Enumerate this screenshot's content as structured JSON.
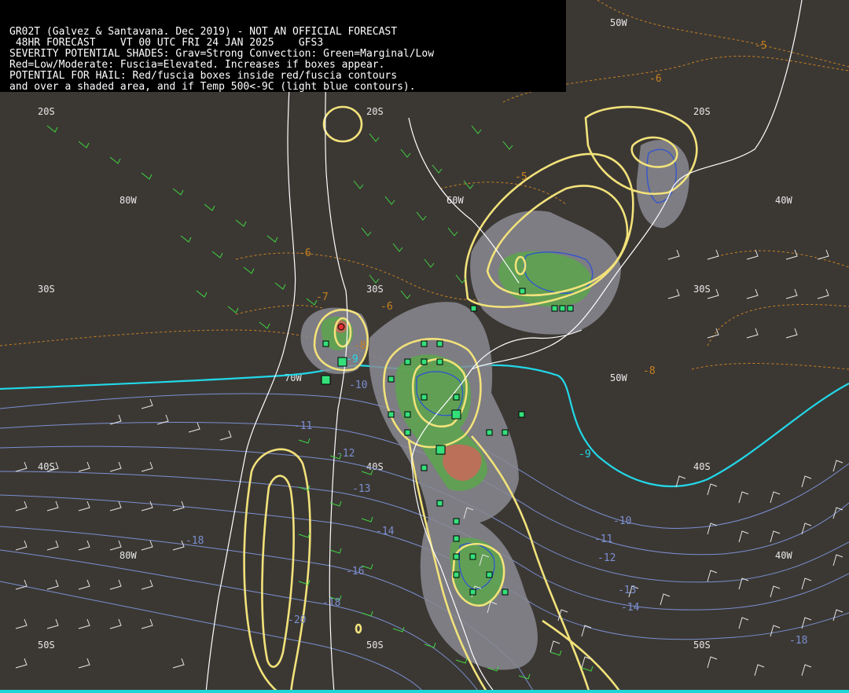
{
  "header": {
    "lines": [
      "GR02T (Galvez & Santavana. Dec 2019) - NOT AN OFFICIAL FORECAST",
      " 48HR FORECAST    VT 00 UTC FRI 24 JAN 2025    GFS3",
      "SEVERITY POTENTIAL SHADES: Grav=Strong Convection: Green=Marginal/Low",
      "Red=Low/Moderate: Fuscia=Elevated. Increases if boxes appear.",
      "POTENTIAL FOR HAIL: Red/fuscia boxes inside red/fuscia contours",
      "and over a shaded area, and if Temp 500<-9C (light blue contours)."
    ]
  },
  "grid_labels": {
    "lat_20s": "20S",
    "lat_30s": "30S",
    "lat_40s": "40S",
    "lat_50s": "50S",
    "lon_80w": "80W",
    "lon_70w": "70W",
    "lon_60w": "60W",
    "lon_50w": "50W",
    "lon_40w": "40W"
  },
  "contour_labels": {
    "t_m5": "-5",
    "t_m6": "-6",
    "t_m7": "-7",
    "t_m8": "-8",
    "t_m9": "-9",
    "t_m10": "-10",
    "t_m11": "-11",
    "t_m12": "-12",
    "t_m13": "-13",
    "t_m14": "-14",
    "t_m16": "-16",
    "t_m18": "-18",
    "t_m20": "-20"
  },
  "colors": {
    "background": "#3b3834",
    "coastline": "#ffffff",
    "severity_gray": "#8a8a92",
    "severity_green": "#5aa84a",
    "severity_red": "#c46a5a",
    "hail_box": "#34e07a",
    "lifted_contour_yellow": "#f2e27a",
    "temp500_minus9": "#22d8e8",
    "temp500_contours": "#7b8fd0",
    "temp_orange_dashed": "#c8801e",
    "wind_barbs_green": "#3fd63f",
    "wind_barbs_white": "#e6e6e6"
  }
}
